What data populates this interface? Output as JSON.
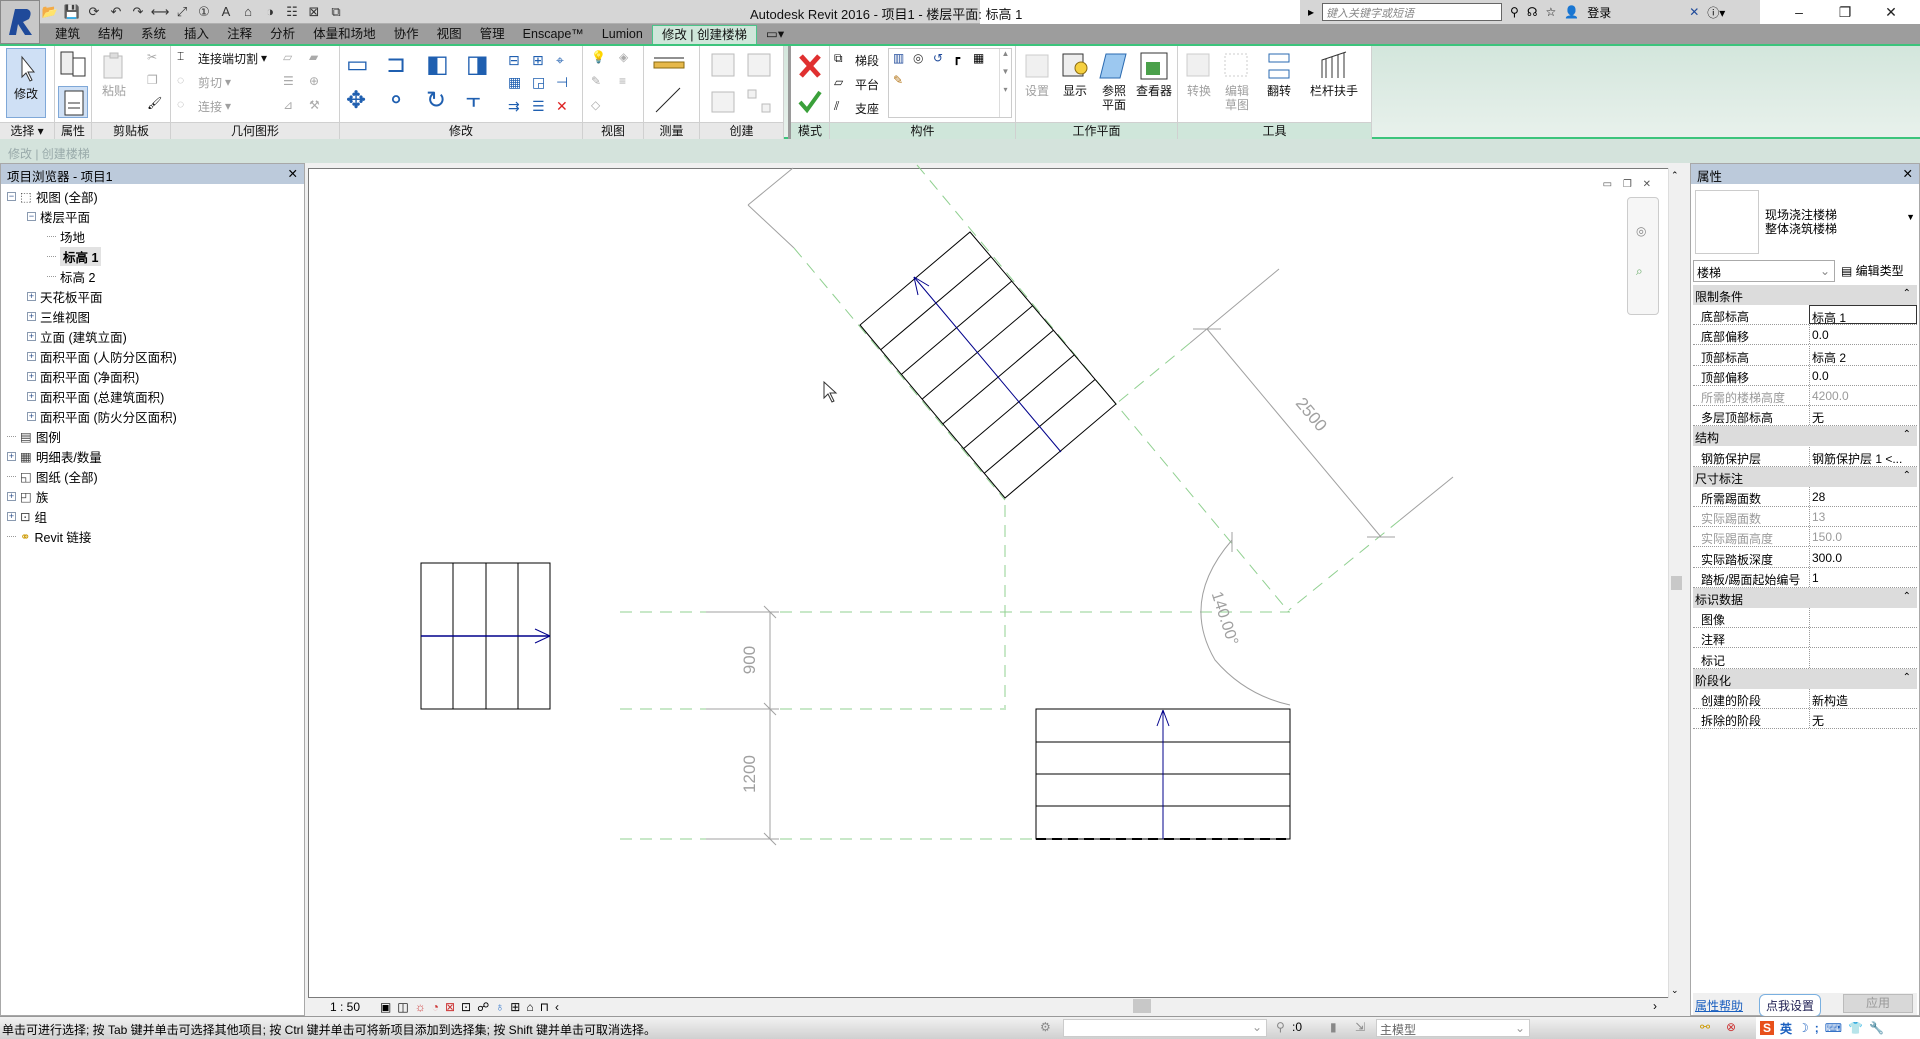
{
  "window": {
    "title": "Autodesk Revit 2016 -     项目1 - 楼层平面: 标高 1",
    "search_placeholder": "键入关键字或短语",
    "login": "登录"
  },
  "qat_icons": [
    "open-icon",
    "save-icon",
    "sync-icon",
    "undo-icon",
    "redo-icon",
    "measure-icon",
    "dimension-icon",
    "tag-icon",
    "text-icon",
    "3d-view-icon",
    "section-icon",
    "thin-lines-icon",
    "close-hidden-icon",
    "switch-windows-icon"
  ],
  "tabs": [
    {
      "label": "建筑"
    },
    {
      "label": "结构"
    },
    {
      "label": "系统"
    },
    {
      "label": "插入"
    },
    {
      "label": "注释"
    },
    {
      "label": "分析"
    },
    {
      "label": "体量和场地"
    },
    {
      "label": "协作"
    },
    {
      "label": "视图"
    },
    {
      "label": "管理"
    },
    {
      "label": "Enscape™"
    },
    {
      "label": "Lumion"
    },
    {
      "label": "修改 | 创建楼梯",
      "active": true
    }
  ],
  "ribbon": {
    "panels": {
      "select": "选择 ▾",
      "properties": "属性",
      "clipboard": "剪贴板",
      "geometry": "几何图形",
      "modify": "修改",
      "view": "视图",
      "measure": "测量",
      "create": "创建",
      "mode": "模式",
      "components": "构件",
      "workplane": "工作平面",
      "tools": "工具"
    },
    "buttons": {
      "modify": "修改",
      "paste": "粘贴",
      "cut_join": "连接端切割",
      "cut": "剪切",
      "join": "连接",
      "run": "梯段",
      "landing": "平台",
      "support": "支座",
      "set": "设置",
      "show": "显示",
      "ref_plane_1": "参照",
      "ref_plane_2": "平面",
      "viewer": "查看器",
      "convert": "转换",
      "edit_sketch_1": "编辑",
      "edit_sketch_2": "草图",
      "flip": "翻转",
      "railing": "栏杆扶手"
    }
  },
  "options_bar": {
    "label": "修改 | 创建楼梯"
  },
  "browser": {
    "title": "项目浏览器 - 项目1",
    "items": [
      {
        "label": "视图 (全部)",
        "level": 0,
        "exp": "−",
        "icon": "views-icon"
      },
      {
        "label": "楼层平面",
        "level": 1,
        "exp": "−"
      },
      {
        "label": "场地",
        "level": 2
      },
      {
        "label": "标高 1",
        "level": 2,
        "selected": true
      },
      {
        "label": "标高 2",
        "level": 2
      },
      {
        "label": "天花板平面",
        "level": 1,
        "exp": "+"
      },
      {
        "label": "三维视图",
        "level": 1,
        "exp": "+"
      },
      {
        "label": "立面 (建筑立面)",
        "level": 1,
        "exp": "+"
      },
      {
        "label": "面积平面 (人防分区面积)",
        "level": 1,
        "exp": "+"
      },
      {
        "label": "面积平面 (净面积)",
        "level": 1,
        "exp": "+"
      },
      {
        "label": "面积平面 (总建筑面积)",
        "level": 1,
        "exp": "+"
      },
      {
        "label": "面积平面 (防火分区面积)",
        "level": 1,
        "exp": "+"
      },
      {
        "label": "图例",
        "level": 0,
        "icon": "legend-icon"
      },
      {
        "label": "明细表/数量",
        "level": 0,
        "exp": "+",
        "icon": "schedule-icon"
      },
      {
        "label": "图纸 (全部)",
        "level": 0,
        "icon": "sheet-icon"
      },
      {
        "label": "族",
        "level": 0,
        "exp": "+",
        "icon": "family-icon"
      },
      {
        "label": "组",
        "level": 0,
        "exp": "+",
        "icon": "group-icon"
      },
      {
        "label": "Revit 链接",
        "level": 0,
        "icon": "link-icon"
      }
    ]
  },
  "drawing": {
    "dim_2500": "2500",
    "dim_900": "900",
    "dim_1200": "1200",
    "angle": "140.00°",
    "tread_count_angled": 7
  },
  "view_bar": {
    "scale": "1 : 50"
  },
  "properties": {
    "title": "属性",
    "type_line1": "现场浇注楼梯",
    "type_line2": "整体浇筑楼梯",
    "category": "楼梯",
    "edit_type": "编辑类型",
    "rows": [
      {
        "group": "限制条件"
      },
      {
        "k": "底部标高",
        "v": "标高 1",
        "edit": true
      },
      {
        "k": "底部偏移",
        "v": "0.0"
      },
      {
        "k": "顶部标高",
        "v": "标高 2"
      },
      {
        "k": "顶部偏移",
        "v": "0.0"
      },
      {
        "k": "所需的楼梯高度",
        "v": "4200.0",
        "gray": true
      },
      {
        "k": "多层顶部标高",
        "v": "无"
      },
      {
        "group": "结构"
      },
      {
        "k": "钢筋保护层",
        "v": "钢筋保护层 1 <..."
      },
      {
        "group": "尺寸标注"
      },
      {
        "k": "所需踢面数",
        "v": "28"
      },
      {
        "k": "实际踢面数",
        "v": "13",
        "gray": true
      },
      {
        "k": "实际踢面高度",
        "v": "150.0",
        "gray": true
      },
      {
        "k": "实际踏板深度",
        "v": "300.0"
      },
      {
        "k": "踏板/踢面起始编号",
        "v": "1"
      },
      {
        "group": "标识数据"
      },
      {
        "k": "图像",
        "v": ""
      },
      {
        "k": "注释",
        "v": ""
      },
      {
        "k": "标记",
        "v": ""
      },
      {
        "group": "阶段化"
      },
      {
        "k": "创建的阶段",
        "v": "新构造"
      },
      {
        "k": "拆除的阶段",
        "v": "无"
      }
    ],
    "help": "属性帮助",
    "tooltip": "点我设置",
    "apply": "应用"
  },
  "status": {
    "message": "单击可进行选择; 按 Tab 键并单击可选择其他项目; 按 Ctrl 键并单击可将新项目添加到选择集; 按 Shift 键并单击可取消选择。",
    "filter_count": ":0",
    "model": "主模型",
    "ime": "英"
  },
  "colors": {
    "accent": "#3cc47c",
    "stair_path": "#00008b",
    "sketch_green": "#90d090",
    "dim_gray": "#a0a0a0"
  }
}
